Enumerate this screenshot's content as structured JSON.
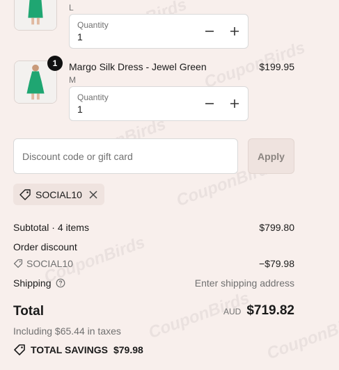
{
  "items": [
    {
      "title": "",
      "price": "",
      "variant": "L",
      "quantity_label": "Quantity",
      "quantity": "1",
      "badge": ""
    },
    {
      "title": "Margo Silk Dress - Jewel Green",
      "price": "$199.95",
      "variant": "M",
      "quantity_label": "Quantity",
      "quantity": "1",
      "badge": "1"
    }
  ],
  "discount": {
    "placeholder": "Discount code or gift card",
    "apply_label": "Apply",
    "applied_code": "SOCIAL10"
  },
  "summary": {
    "subtotal_label": "Subtotal · 4 items",
    "subtotal_value": "$799.80",
    "order_discount_label": "Order discount",
    "discount_code": "SOCIAL10",
    "discount_value": "−$79.98",
    "shipping_label": "Shipping",
    "shipping_value": "Enter shipping address",
    "total_label": "Total",
    "currency": "AUD",
    "total_value": "$719.82",
    "taxes_note": "Including $65.44 in taxes",
    "savings_label": "TOTAL SAVINGS",
    "savings_value": "$79.98"
  },
  "watermark": "CouponBirds",
  "colors": {
    "background": "#f8efec",
    "dress_green": "#1fa672",
    "chip_bg": "#efe3df"
  }
}
